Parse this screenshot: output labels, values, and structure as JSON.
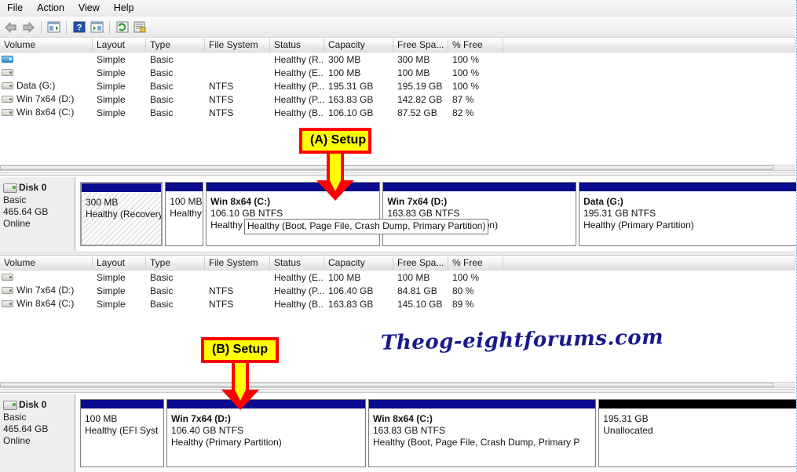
{
  "window": {
    "menus": [
      "File",
      "Action",
      "View",
      "Help"
    ],
    "toolbar_icons": [
      "back-arrow-icon",
      "forward-arrow-icon",
      "show-hide-console-tree-icon",
      "help-icon",
      "show-hide-action-pane-icon",
      "refresh-icon",
      "properties-icon"
    ]
  },
  "colors": {
    "partition_bar": "#0b0b8f",
    "unallocated_bar": "#000000",
    "callout_fill": "#ffff00",
    "callout_border": "#ff0000",
    "watermark": "#1a1a8c"
  },
  "top_pane": {
    "columns": [
      "Volume",
      "Layout",
      "Type",
      "File System",
      "Status",
      "Capacity",
      "Free Spa...",
      "% Free"
    ],
    "rows": [
      {
        "volume": "",
        "layout": "Simple",
        "type": "Basic",
        "fs": "",
        "status": "Healthy (R...",
        "capacity": "300 MB",
        "free": "300 MB",
        "pct": "100 %",
        "selected": true
      },
      {
        "volume": "",
        "layout": "Simple",
        "type": "Basic",
        "fs": "",
        "status": "Healthy (E...",
        "capacity": "100 MB",
        "free": "100 MB",
        "pct": "100 %",
        "selected": false
      },
      {
        "volume": "Data (G:)",
        "layout": "Simple",
        "type": "Basic",
        "fs": "NTFS",
        "status": "Healthy (P...",
        "capacity": "195.31 GB",
        "free": "195.19 GB",
        "pct": "100 %",
        "selected": false
      },
      {
        "volume": "Win 7x64 (D:)",
        "layout": "Simple",
        "type": "Basic",
        "fs": "NTFS",
        "status": "Healthy (P...",
        "capacity": "163.83 GB",
        "free": "142.82 GB",
        "pct": "87 %",
        "selected": false
      },
      {
        "volume": "Win 8x64 (C:)",
        "layout": "Simple",
        "type": "Basic",
        "fs": "NTFS",
        "status": "Healthy (B...",
        "capacity": "106.10 GB",
        "free": "87.52 GB",
        "pct": "82 %",
        "selected": false
      }
    ]
  },
  "top_disk": {
    "name": "Disk 0",
    "type": "Basic",
    "size": "465.64 GB",
    "state": "Online",
    "partitions": [
      {
        "name": "",
        "size": "300 MB",
        "fs": "",
        "status": "Healthy (Recovery",
        "selected": true,
        "unallocated": false,
        "width_pct": 11.6
      },
      {
        "name": "",
        "size": "100 MB",
        "fs": "",
        "status": "Healthy (EFI S)",
        "selected": false,
        "unallocated": false,
        "width_pct": 5.4
      },
      {
        "name": "Win 8x64  (C:)",
        "size": "106.10 GB NTFS",
        "fs": "",
        "status": "Healthy (Boot, Page File, Crash Dump, Primary Partition)",
        "selected": false,
        "unallocated": false,
        "width_pct": 24.5
      },
      {
        "name": "Win 7x64  (D:)",
        "size": "163.83 GB NTFS",
        "fs": "",
        "status": "Healthy (Primary Partition)",
        "selected": false,
        "unallocated": false,
        "width_pct": 27.2
      },
      {
        "name": "Data  (G:)",
        "size": "195.31 GB NTFS",
        "fs": "",
        "status": "Healthy (Primary Partition)",
        "selected": false,
        "unallocated": false,
        "width_pct": 31.3
      }
    ],
    "tooltip": "Healthy (Boot, Page File, Crash Dump, Primary Partition)"
  },
  "bottom_pane": {
    "columns": [
      "Volume",
      "Layout",
      "Type",
      "File System",
      "Status",
      "Capacity",
      "Free Spa...",
      "% Free"
    ],
    "rows": [
      {
        "volume": "",
        "layout": "Simple",
        "type": "Basic",
        "fs": "",
        "status": "Healthy (E...",
        "capacity": "100 MB",
        "free": "100 MB",
        "pct": "100 %",
        "selected": false
      },
      {
        "volume": "Win 7x64 (D:)",
        "layout": "Simple",
        "type": "Basic",
        "fs": "NTFS",
        "status": "Healthy (P...",
        "capacity": "106.40 GB",
        "free": "84.81 GB",
        "pct": "80 %",
        "selected": false
      },
      {
        "volume": "Win 8x64 (C:)",
        "layout": "Simple",
        "type": "Basic",
        "fs": "NTFS",
        "status": "Healthy (B...",
        "capacity": "163.83 GB",
        "free": "145.10 GB",
        "pct": "89 %",
        "selected": false
      }
    ]
  },
  "bottom_disk": {
    "name": "Disk 0",
    "type": "Basic",
    "size": "465.64 GB",
    "state": "Online",
    "partitions": [
      {
        "name": "",
        "size": "100 MB",
        "fs": "",
        "status": "Healthy (EFI Syst",
        "selected": false,
        "unallocated": false,
        "width_pct": 11.8
      },
      {
        "name": "Win 7x64  (D:)",
        "size": "106.40 GB NTFS",
        "fs": "",
        "status": "Healthy (Primary Partition)",
        "selected": false,
        "unallocated": false,
        "width_pct": 28.0
      },
      {
        "name": "Win 8x64  (C:)",
        "size": "163.83 GB NTFS",
        "fs": "",
        "status": "Healthy (Boot, Page File, Crash Dump, Primary P",
        "selected": false,
        "unallocated": false,
        "width_pct": 32.0
      },
      {
        "name": "",
        "size": "195.31 GB",
        "fs": "",
        "status": "Unallocated",
        "selected": false,
        "unallocated": true,
        "width_pct": 28.2
      }
    ]
  },
  "annotations": {
    "callout_a": "(A) Setup",
    "callout_b": "(B) Setup",
    "watermark": "Theog-eightforums.com"
  }
}
